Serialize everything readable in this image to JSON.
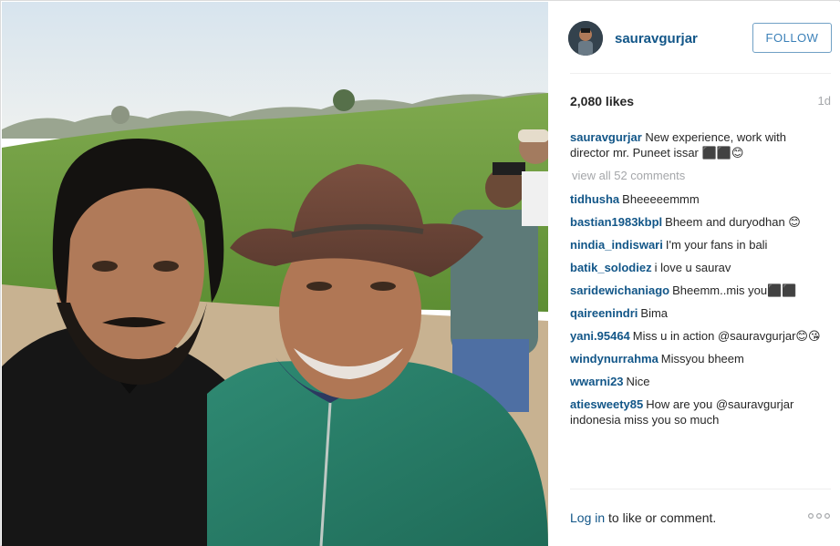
{
  "post": {
    "username": "sauravgurjar",
    "follow_label": "FOLLOW",
    "likes": "2,080 likes",
    "age": "1d",
    "caption_text": "New experience, work with director mr. Puneet issar ⬛⬛😊",
    "view_all": "view all 52 comments",
    "comments": [
      {
        "user": "tidhusha",
        "text": "Bheeeeemmm"
      },
      {
        "user": "bastian1983kbpl",
        "text": "Bheem and duryodhan 😊"
      },
      {
        "user": "nindia_indiswari",
        "text": "I'm your fans in bali"
      },
      {
        "user": "batik_solodiez",
        "text": "i love u saurav"
      },
      {
        "user": "saridewichaniago",
        "text": "Bheemm..mis you⬛⬛"
      },
      {
        "user": "qaireenindri",
        "text": "Bima"
      },
      {
        "user": "yani.95464",
        "text": "Miss u in action @sauravgurjar😊😘"
      },
      {
        "user": "windynurrahma",
        "text": "Missyou bheem"
      },
      {
        "user": "wwarni23",
        "text": "Nice"
      },
      {
        "user": "atiesweety85",
        "text": "How are you @sauravgurjar indonesia miss you so much"
      }
    ],
    "footer_login": "Log in",
    "footer_rest": " to like or comment."
  },
  "icons": {
    "more": "more-options-icon",
    "avatar": "avatar"
  },
  "colors": {
    "username": "#125688",
    "follow": "#3b80b8",
    "muted": "#a5a7aa"
  }
}
